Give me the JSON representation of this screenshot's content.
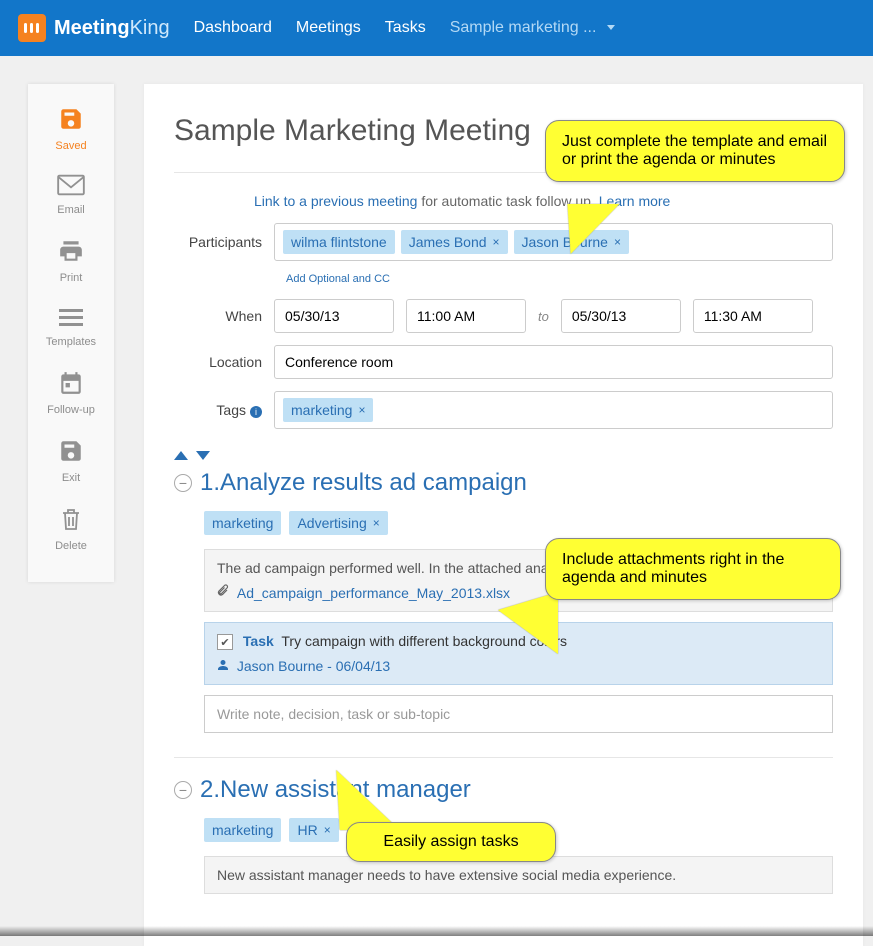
{
  "brand": {
    "name1": "Meeting",
    "name2": "King"
  },
  "nav": {
    "dashboard": "Dashboard",
    "meetings": "Meetings",
    "tasks": "Tasks",
    "current": "Sample marketing ..."
  },
  "sidebar": {
    "saved": "Saved",
    "email": "Email",
    "print": "Print",
    "templates": "Templates",
    "followup": "Follow-up",
    "exit": "Exit",
    "delete": "Delete"
  },
  "page": {
    "title": "Sample Marketing Meeting"
  },
  "linkrow": {
    "link_prev": "Link to a previous meeting",
    "suffix": " for automatic task follow up. ",
    "learn": "Learn more"
  },
  "labels": {
    "participants": "Participants",
    "when": "When",
    "to": "to",
    "location": "Location",
    "tags": "Tags",
    "add_opt": "Add Optional and CC"
  },
  "participants": [
    {
      "name": "wilma flintstone",
      "removable": false
    },
    {
      "name": "James Bond",
      "removable": true
    },
    {
      "name": "Jason Bourne",
      "removable": true
    }
  ],
  "when": {
    "start_date": "05/30/13",
    "start_time": "11:00 AM",
    "end_date": "05/30/13",
    "end_time": "11:30 AM"
  },
  "location": "Conference room",
  "tags": [
    {
      "name": "marketing",
      "removable": true
    }
  ],
  "agenda": [
    {
      "number": "1.",
      "title": "Analyze results ad campaign",
      "tags": [
        {
          "name": "marketing",
          "removable": false
        },
        {
          "name": "Advertising",
          "removable": true
        }
      ],
      "note": "The ad campaign performed well. In the attached analysis you can find all details.",
      "attachment": "Ad_campaign_performance_May_2013.xlsx",
      "task": {
        "label": "Task",
        "text": " Try campaign with different background colors",
        "assignee": "Jason Bourne - 06/04/13"
      },
      "placeholder": "Write note, decision, task or sub-topic"
    },
    {
      "number": "2.",
      "title": "New assistant manager",
      "tags": [
        {
          "name": "marketing",
          "removable": false
        },
        {
          "name": "HR",
          "removable": true
        }
      ],
      "note": "New assistant manager needs to have extensive social media experience."
    }
  ],
  "callouts": {
    "c1": "Just complete the template and email or print the agenda or minutes",
    "c2": "Include attachments right in the agenda and minutes",
    "c3": "Easily assign tasks"
  }
}
